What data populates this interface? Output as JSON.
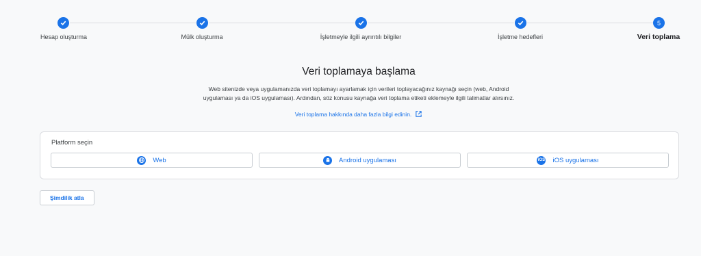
{
  "stepper": {
    "steps": [
      {
        "label": "Hesap oluşturma",
        "state": "done"
      },
      {
        "label": "Mülk oluşturma",
        "state": "done"
      },
      {
        "label": "İşletmeyle ilgili ayrıntılı bilgiler",
        "state": "done"
      },
      {
        "label": "İşletme hedefleri",
        "state": "done"
      },
      {
        "label": "Veri toplama",
        "state": "active",
        "number": "5"
      }
    ]
  },
  "main": {
    "title": "Veri toplamaya başlama",
    "description_line1": "Web sitenizde veya uygulamanızda veri toplamayı ayarlamak için verileri toplayacağınız kaynağı seçin (web, Android",
    "description_line2": "uygulaması ya da iOS uygulaması). Ardından, söz konusu kaynağa veri toplama etiketi eklemeyle ilgili talimatlar alırsınız.",
    "learn_more": "Veri toplama hakkında daha fazla bilgi edinin."
  },
  "platform": {
    "label": "Platform seçin",
    "options": [
      {
        "label": "Web",
        "icon": "globe-icon"
      },
      {
        "label": "Android uygulaması",
        "icon": "android-icon"
      },
      {
        "label": "iOS uygulaması",
        "icon": "ios-icon",
        "icon_text": "iOS"
      }
    ]
  },
  "actions": {
    "skip": "Şimdilik atla"
  },
  "colors": {
    "accent": "#1a73e8",
    "background": "#f8f9fa"
  }
}
